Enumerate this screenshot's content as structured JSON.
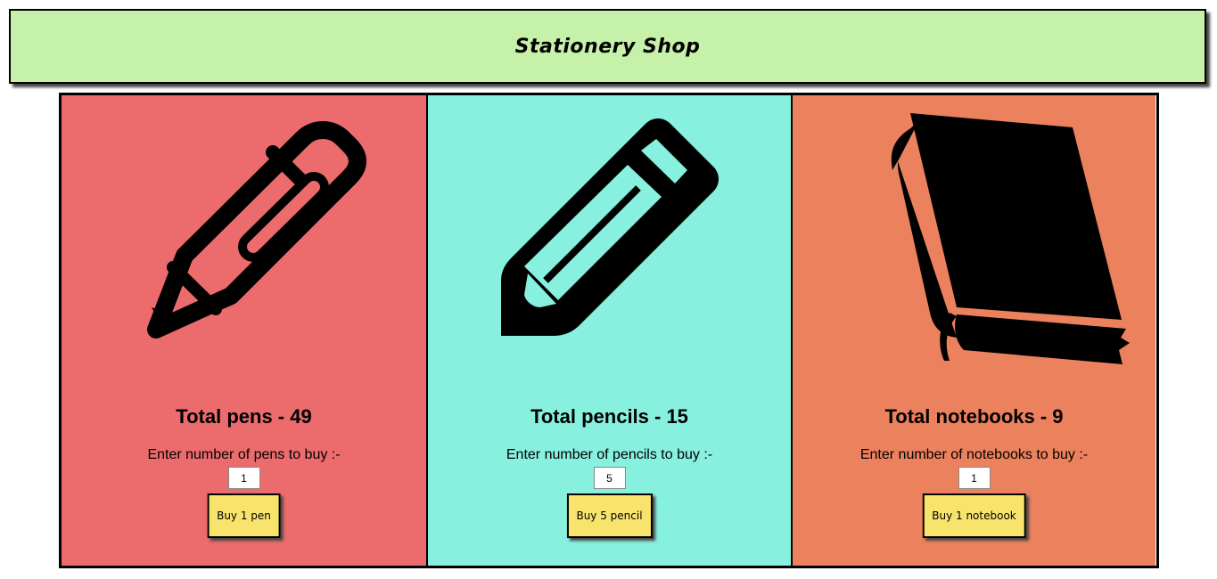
{
  "header": {
    "title": "Stationery Shop"
  },
  "items": [
    {
      "icon": "pen-icon",
      "total_label": "Total pens - 49",
      "prompt": "Enter number of pens to buy :-",
      "quantity": "1",
      "button_label": "Buy 1 pen",
      "background": "#ec6b6d"
    },
    {
      "icon": "pencil-icon",
      "total_label": "Total pencils - 15",
      "prompt": "Enter number of pencils to buy :-",
      "quantity": "5",
      "button_label": "Buy 5 pencil",
      "background": "#88f0de"
    },
    {
      "icon": "notebook-icon",
      "total_label": "Total notebooks - 9",
      "prompt": "Enter number of notebooks to buy :-",
      "quantity": "1",
      "button_label": "Buy 1 notebook",
      "background": "#ec815d"
    }
  ],
  "colors": {
    "header_background": "#c6f1a9",
    "button_background": "#f8e36d",
    "border": "#000000"
  }
}
